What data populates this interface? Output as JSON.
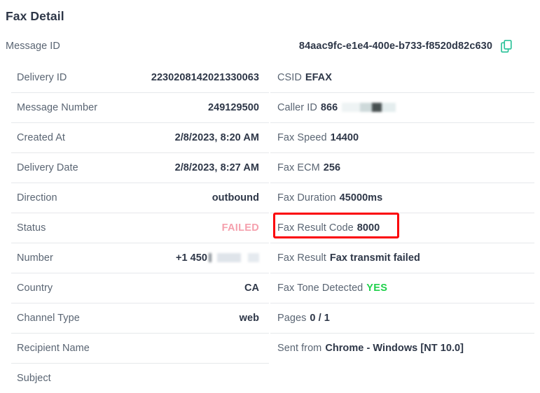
{
  "header": {
    "title": "Fax Detail"
  },
  "message_id_row": {
    "label": "Message ID",
    "value": "84aac9fc-e1e4-400e-b733-f8520d82c630",
    "copy_icon": "copy-icon"
  },
  "left_column": [
    {
      "label": "Delivery ID",
      "value": "2230208142021330063"
    },
    {
      "label": "Message Number",
      "value": "249129500"
    },
    {
      "label": "Created At",
      "value": "2/8/2023, 8:20 AM"
    },
    {
      "label": "Delivery Date",
      "value": "2/8/2023, 8:27 AM"
    },
    {
      "label": "Direction",
      "value": "outbound"
    },
    {
      "label": "Status",
      "value": "FAILED"
    },
    {
      "label": "Number",
      "value": "+1 450"
    },
    {
      "label": "Country",
      "value": "CA"
    },
    {
      "label": "Channel Type",
      "value": "web"
    },
    {
      "label": "Recipient Name",
      "value": ""
    },
    {
      "label": "Subject",
      "value": ""
    }
  ],
  "right_column": [
    {
      "label": "CSID",
      "value": "EFAX"
    },
    {
      "label": "Caller ID",
      "value": "866"
    },
    {
      "label": "Fax Speed",
      "value": "14400"
    },
    {
      "label": "Fax ECM",
      "value": "256"
    },
    {
      "label": "Fax Duration",
      "value": "45000ms"
    },
    {
      "label": "Fax Result Code",
      "value": "8000"
    },
    {
      "label": "Fax Result",
      "value": "Fax transmit failed"
    },
    {
      "label": "Fax Tone Detected",
      "value": "YES"
    },
    {
      "label": "Pages",
      "value": "0 / 1"
    },
    {
      "label": "Sent from",
      "value": "Chrome - Windows [NT 10.0]"
    },
    {
      "label": "",
      "value": ""
    }
  ],
  "colors": {
    "status_failed": "#f5a0ad",
    "tone_yes": "#1fd14b",
    "copy_icon": "#2fc39b",
    "highlight_border": "#fb0007",
    "label_text": "#5a6573",
    "value_text": "#2e3748",
    "divider": "#e6e8eb"
  }
}
